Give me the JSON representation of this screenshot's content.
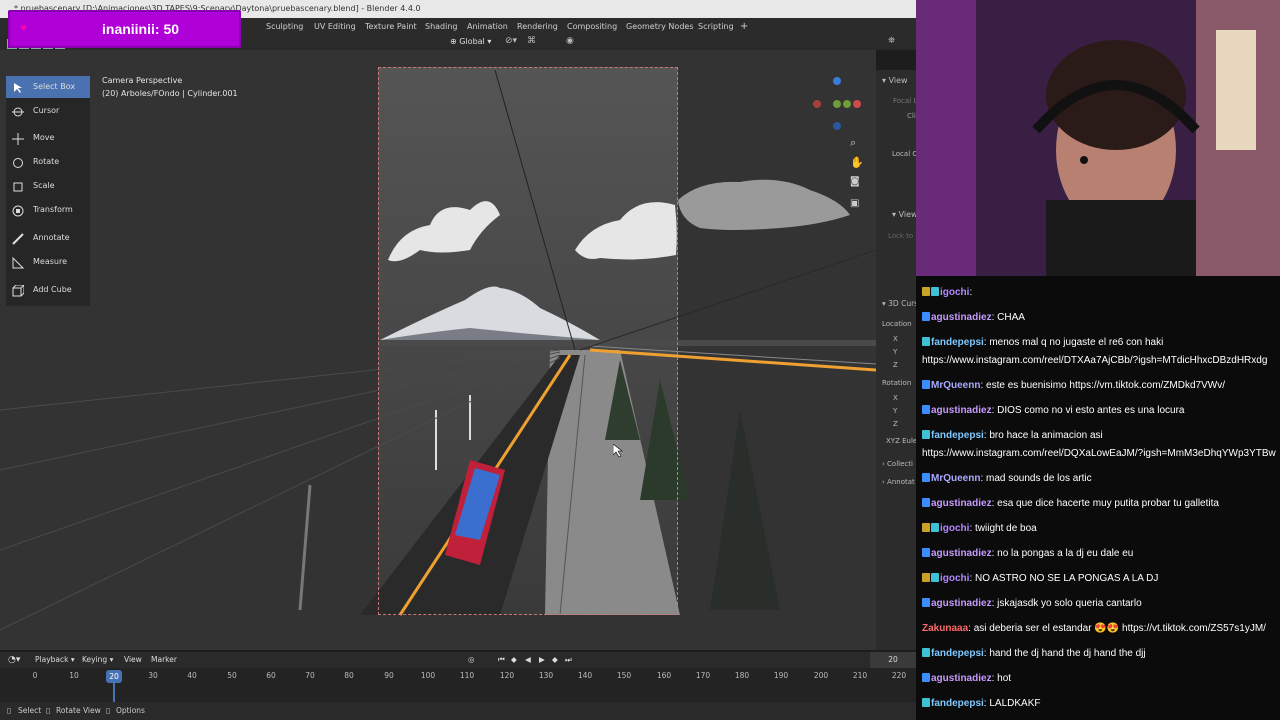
{
  "window": {
    "title": "* pruebascenary [D:\\Animaciones\\3D TAPES\\9:Scenary\\Daytona\\pruebascenary.blend] - Blender 4.4.0"
  },
  "overlay": {
    "badge_text": "inaniinii: 50"
  },
  "workspace_tabs": [
    "Sculpting",
    "UV Editing",
    "Texture Paint",
    "Shading",
    "Animation",
    "Rendering",
    "Compositing",
    "Geometry Nodes",
    "Scripting",
    "+"
  ],
  "header": {
    "transform_orientation": "Global"
  },
  "tools": [
    {
      "label": "Select Box",
      "icon": "select-box-icon",
      "active": true
    },
    {
      "label": "Cursor",
      "icon": "cursor-icon"
    },
    {
      "label": "Move",
      "icon": "move-icon"
    },
    {
      "label": "Rotate",
      "icon": "rotate-icon"
    },
    {
      "label": "Scale",
      "icon": "scale-icon"
    },
    {
      "label": "Transform",
      "icon": "transform-icon"
    },
    {
      "label": "Annotate",
      "icon": "annotate-icon"
    },
    {
      "label": "Measure",
      "icon": "measure-icon"
    },
    {
      "label": "Add Cube",
      "icon": "add-cube-icon"
    }
  ],
  "viewport": {
    "info_line1": "Camera Perspective",
    "info_line2": "(20) Arboles/FOndo | Cylinder.001"
  },
  "properties": {
    "view": "View",
    "focal": "Focal L",
    "clip": "Cli",
    "local_camera": "Local C",
    "view2": "View",
    "lock_to": "Lock to",
    "cursor": "3D Curs",
    "location": "Location",
    "rotation": "Rotation",
    "axes": [
      "X",
      "Y",
      "Z"
    ],
    "xyz_euler": "XYZ Eule",
    "collections": "Collecti",
    "annotations": "Annotat"
  },
  "timeline": {
    "menus": [
      "Playback",
      "Keying",
      "View",
      "Marker"
    ],
    "current_frame": "20",
    "ticks": [
      "0",
      "10",
      "20",
      "30",
      "40",
      "50",
      "60",
      "70",
      "80",
      "90",
      "100",
      "110",
      "120",
      "130",
      "140",
      "150",
      "160",
      "170",
      "180",
      "190",
      "200",
      "210",
      "220"
    ]
  },
  "statusbar": {
    "select": "Select",
    "rotate_view": "Rotate View",
    "options": "Options"
  },
  "chat": [
    {
      "user": "igochi",
      "text": ": ",
      "color": "#b388ff"
    },
    {
      "user": "agustinadiez",
      "text": ": CHAA",
      "color": "#c79bff"
    },
    {
      "user": "fandepepsi",
      "text": ": menos mal q no jugaste el re6 con haki",
      "color": "#7fc8ff"
    },
    {
      "user": "",
      "text": "https://www.instagram.com/reel/DTXAa7AjCBb/?igsh=MTdicHhxcDBzdHRxdg",
      "color": "#ffffff"
    },
    {
      "user": "MrQueenn",
      "text": ": este es buenisimo https://vm.tiktok.com/ZMDkd7VWv/",
      "color": "#a9a9ff"
    },
    {
      "user": "agustinadiez",
      "text": ": DIOS como no vi esto antes es una locura",
      "color": "#c79bff"
    },
    {
      "user": "fandepepsi",
      "text": ": bro hace la animacion asi",
      "color": "#7fc8ff"
    },
    {
      "user": "",
      "text": "https://www.instagram.com/reel/DQXaLowEaJM/?igsh=MmM3eDhqYWp3YTBw",
      "color": "#ffffff"
    },
    {
      "user": "MrQueenn",
      "text": ": mad sounds de los artic",
      "color": "#a9a9ff"
    },
    {
      "user": "agustinadiez",
      "text": ": esa que dice hacerte muy putita probar tu galletita",
      "color": "#c79bff"
    },
    {
      "user": "igochi",
      "text": ": twiight de boa",
      "color": "#b388ff"
    },
    {
      "user": "agustinadiez",
      "text": ": no la pongas a la dj eu dale eu",
      "color": "#c79bff"
    },
    {
      "user": "igochi",
      "text": ": NO ASTRO NO SE LA PONGAS A LA DJ",
      "color": "#b388ff"
    },
    {
      "user": "agustinadiez",
      "text": ": jskajasdk yo solo queria cantarlo",
      "color": "#c79bff"
    },
    {
      "user": "Zakunaaa",
      "text": ": asi deberia ser el estandar 😍😍 https://vt.tiktok.com/ZS57s1yJM/",
      "color": "#ff6a6a"
    },
    {
      "user": "fandepepsi",
      "text": ": hand the dj hand the dj hand the djj",
      "color": "#7fc8ff"
    },
    {
      "user": "agustinadiez",
      "text": ": hot",
      "color": "#c79bff"
    },
    {
      "user": "fandepepsi",
      "text": ": LALDKAKF",
      "color": "#7fc8ff"
    }
  ]
}
